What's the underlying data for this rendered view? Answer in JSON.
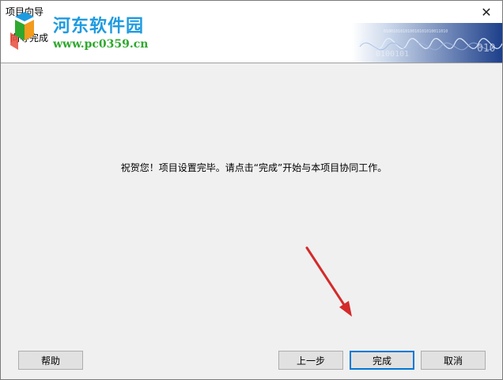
{
  "window": {
    "title": "项目向导",
    "close_glyph": "✕"
  },
  "header": {
    "subtitle": "向导完成",
    "banner_digits_top": "010010101010010101010011010",
    "banner_digits_mid": "0100101",
    "banner_digits_right": "010"
  },
  "watermark": {
    "title": "河东软件园",
    "url": "www.pc0359.cn"
  },
  "main": {
    "message": "祝贺您！项目设置完毕。请点击“完成”开始与本项目协同工作。"
  },
  "buttons": {
    "help": "帮助",
    "back": "上一步",
    "finish": "完成",
    "cancel": "取消"
  },
  "colors": {
    "accent": "#0078d7",
    "watermark_blue": "#1e9be0",
    "watermark_green": "#2ea82e",
    "arrow_red": "#d42a2a"
  }
}
